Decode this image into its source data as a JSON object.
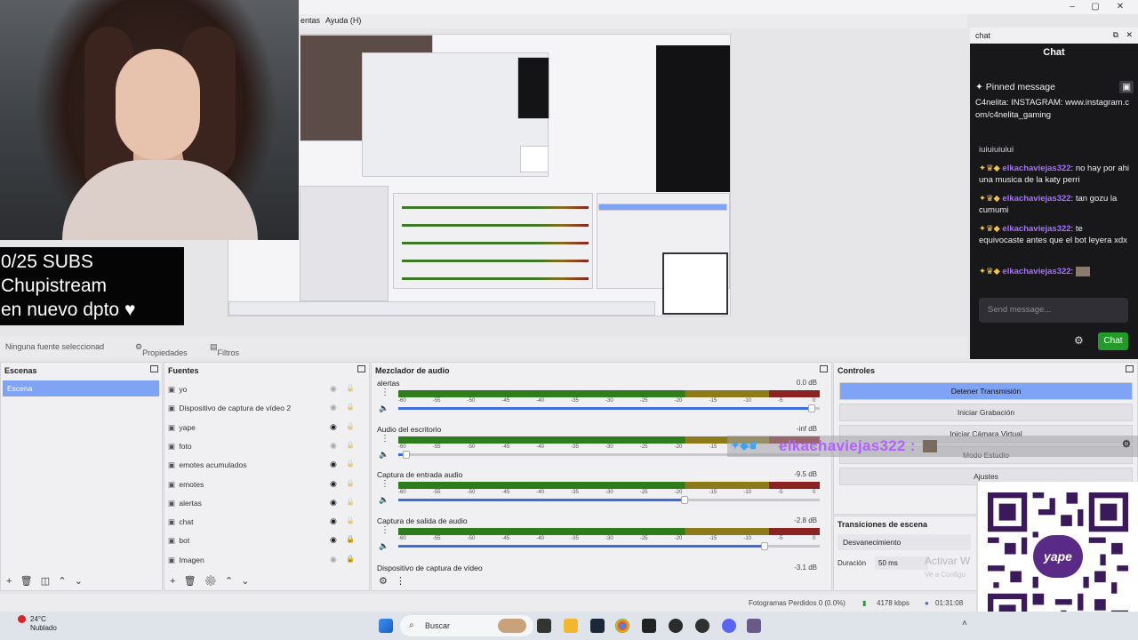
{
  "menu": {
    "item1": "entas",
    "item2": "Ayuda (H)"
  },
  "overlay": {
    "subs_line1": "0/25 SUBS",
    "subs_line2": "Chupistream",
    "subs_line3": "en nuevo dpto ♥",
    "highlight_user": "elkachaviejas322 :"
  },
  "chat": {
    "dock_title": "chat",
    "header": "Chat",
    "pinned_label": "Pinned message",
    "pinned_text": "C4nelita: INSTAGRAM: www.instagram.com/c4nelita_gaming",
    "partial_line": "iuiuiuiuiui",
    "messages": [
      {
        "user": "elkachaviejas322",
        "text": "no hay por ahi una musica de la katy perri"
      },
      {
        "user": "elkachaviejas322",
        "text": "tan gozu la cumumi"
      },
      {
        "user": "elkachaviejas322",
        "text": "te equivocaste antes que el bot leyera xdx"
      },
      {
        "user": "elkachaviejas322",
        "text": ""
      }
    ],
    "send_placeholder": "Send message...",
    "chat_button": "Chat"
  },
  "source_bar": {
    "no_source": "Ninguna fuente seleccionad",
    "properties": "Propiedades",
    "filters": "Filtros"
  },
  "scenes": {
    "title": "Escenas",
    "items": [
      "Escena"
    ]
  },
  "sources": {
    "title": "Fuentes",
    "items": [
      {
        "label": "yo",
        "visible": false,
        "locked": false
      },
      {
        "label": "Dispositivo de captura de vídeo 2",
        "visible": false,
        "locked": false
      },
      {
        "label": "yape",
        "visible": true,
        "locked": false
      },
      {
        "label": "foto",
        "visible": false,
        "locked": false
      },
      {
        "label": "emotes acumulados",
        "visible": true,
        "locked": false
      },
      {
        "label": "emotes",
        "visible": true,
        "locked": false
      },
      {
        "label": "alertas",
        "visible": true,
        "locked": false
      },
      {
        "label": "chat",
        "visible": true,
        "locked": false
      },
      {
        "label": "bot",
        "visible": true,
        "locked": true
      },
      {
        "label": "Imagen",
        "visible": false,
        "locked": true
      }
    ]
  },
  "mixer": {
    "title": "Mezclador de audio",
    "scale_labels": [
      "-60",
      "-55",
      "-50",
      "-45",
      "-40",
      "-35",
      "-30",
      "-25",
      "-20",
      "-15",
      "-10",
      "-5",
      "0"
    ],
    "channels": [
      {
        "name": "alertas",
        "db": "0.0 dB",
        "volume": 0.98
      },
      {
        "name": "Audio del escritorio",
        "db": "-inf dB",
        "volume": 0.02
      },
      {
        "name": "Captura de entrada audio",
        "db": "-9.5 dB",
        "volume": 0.68
      },
      {
        "name": "Captura de salida de audio",
        "db": "-2.8 dB",
        "volume": 0.87
      }
    ],
    "partial_channel": {
      "name": "Dispositivo de captura de vídeo",
      "db": "-3.1 dB"
    }
  },
  "controls": {
    "title": "Controles",
    "buttons": [
      "Detener Transmisión",
      "Iniciar Grabación",
      "Iniciar Cámara Virtual",
      "Modo Estudio",
      "Ajustes"
    ]
  },
  "transitions": {
    "title": "Transiciones de escena",
    "selected": "Desvanecimiento",
    "duration_label": "Duración",
    "duration_value": "50 ms"
  },
  "status": {
    "frames_dropped": "Fotogramas Perdidos 0 (0.0%)",
    "bitrate": "4178 kbps",
    "live_time": "01:31:08"
  },
  "watermark": {
    "line1": "Activar W",
    "line2": "Ve a Configu"
  },
  "taskbar": {
    "weather_temp": "24°C",
    "weather_desc": "Nublado",
    "search_placeholder": "Buscar"
  },
  "yape_logo": "yape"
}
